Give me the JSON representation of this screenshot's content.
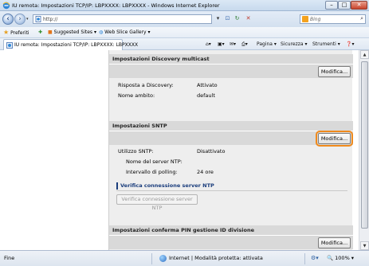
{
  "window": {
    "title": "IU remota: Impostazioni TCP/IP: LBPXXXX: LBPXXXX - Windows Internet Explorer",
    "controls": {
      "minimize": "–",
      "maximize": "□",
      "close": "✕"
    }
  },
  "address_bar": {
    "url": "http://",
    "search_placeholder": "Bing"
  },
  "favorites_bar": {
    "favorites_label": "Preferiti",
    "suggested_sites": "Suggested Sites ▾",
    "web_slice_gallery": "Web Slice Gallery ▾"
  },
  "tab": {
    "label": "IU remota: Impostazioni TCP/IP: LBPXXXX: LBPXXXX"
  },
  "command_bar": {
    "page": "Pagina ▾",
    "safety": "Sicurezza ▾",
    "tools": "Strumenti ▾",
    "help": "❓▾"
  },
  "sections": {
    "discovery": {
      "header": "Impostazioni Discovery multicast",
      "edit_button": "Modifica...",
      "rows": [
        {
          "label": "Risposta a Discovery:",
          "value": "Attivato"
        },
        {
          "label": "Nome ambito:",
          "value": "default"
        }
      ]
    },
    "sntp": {
      "header": "Impostazioni SNTP",
      "edit_button": "Modifica...",
      "rows": [
        {
          "label": "Utilizzo SNTP:",
          "value": "Disattivato"
        },
        {
          "label": "Nome del server NTP:",
          "value": ""
        },
        {
          "label": "Intervallo di polling:",
          "value": "24 ore"
        }
      ],
      "verify_title": "Verifica connessione server NTP",
      "verify_button": "Verifica connessione server NTP"
    },
    "pin": {
      "header": "Impostazioni conferma PIN gestione ID divisione",
      "edit_button": "Modifica..."
    }
  },
  "status_bar": {
    "status": "Fine",
    "zone": "Internet | Modalità protetta: attivata",
    "zoom": "100%",
    "zoom_label": "🔍 100% ▾"
  },
  "colors": {
    "highlight": "#f08a1c",
    "verify_title": "#1a3d7c",
    "section_header": "#d9d9d9"
  }
}
